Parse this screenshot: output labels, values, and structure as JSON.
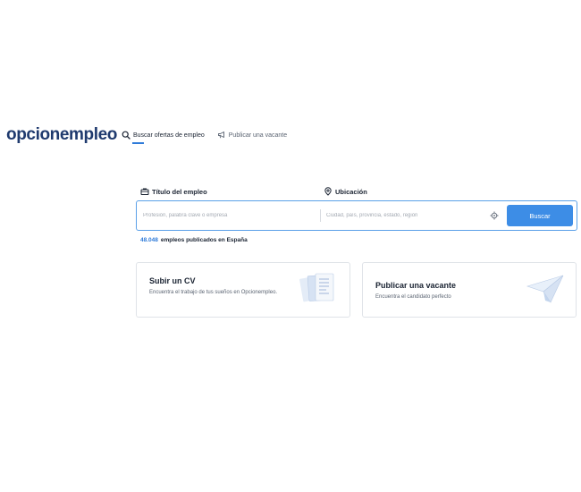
{
  "header": {
    "logo": "opcionempleo",
    "nav": [
      {
        "label": "Buscar ofertas de empleo",
        "icon": "search-icon"
      },
      {
        "label": "Publicar una vacante",
        "icon": "megaphone-icon"
      }
    ]
  },
  "search": {
    "title_label": "Título del empleo",
    "title_icon": "briefcase-icon",
    "title_placeholder": "Profesión, palabra clave o empresa",
    "location_label": "Ubicación",
    "location_icon": "location-pin-icon",
    "location_placeholder": "Ciudad, país, provincia, estado, región",
    "locate_icon": "crosshair-icon",
    "button_label": "Buscar"
  },
  "stats": {
    "count": "48.048",
    "label": "empleos publicados en España"
  },
  "cards": [
    {
      "title": "Subir un CV",
      "description": "Encuentra el trabajo de tus sueños en Opcionempleo.",
      "icon": "cv-documents-icon"
    },
    {
      "title": "Publicar una vacante",
      "description": "Encuentra el candidato perfecto",
      "icon": "paper-plane-icon"
    }
  ],
  "colors": {
    "brand": "#1f3a6e",
    "accent": "#3d8de6",
    "border": "#dfe3e8"
  }
}
